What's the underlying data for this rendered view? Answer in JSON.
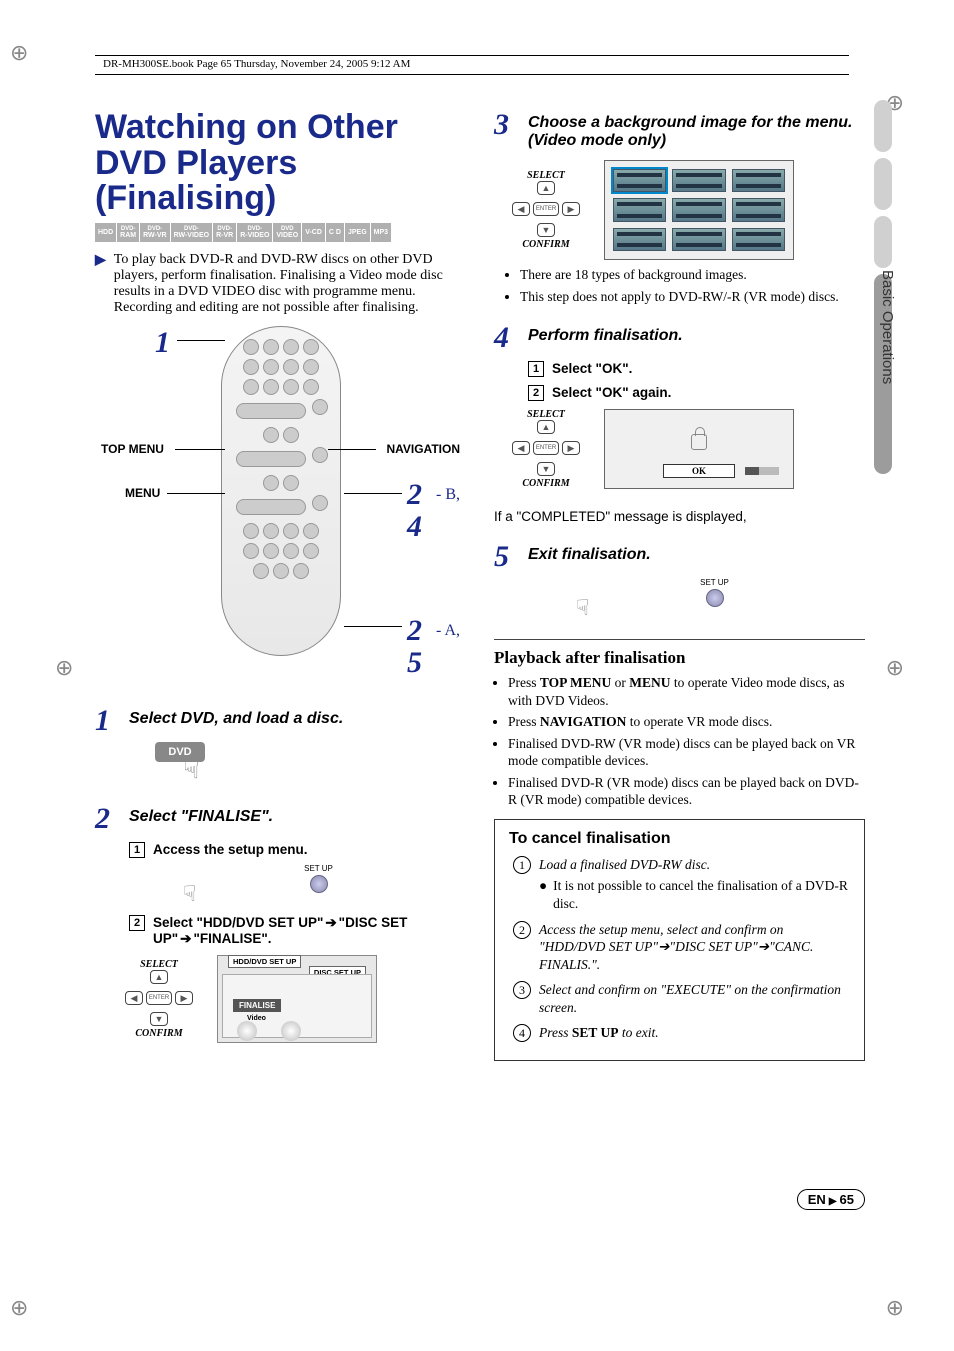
{
  "header_text": "DR-MH300SE.book  Page 65  Thursday, November 24, 2005  9:12 AM",
  "side_label": "Basic Operations",
  "title": "Watching on Other DVD Players (Finalising)",
  "badges": [
    {
      "l1": "",
      "l2": "HDD"
    },
    {
      "l1": "DVD-",
      "l2": "RAM"
    },
    {
      "l1": "DVD-",
      "l2": "RW-VR"
    },
    {
      "l1": "DVD-",
      "l2": "RW-VIDEO"
    },
    {
      "l1": "DVD-",
      "l2": "R-VR"
    },
    {
      "l1": "DVD-",
      "l2": "R-VIDEO"
    },
    {
      "l1": "DVD",
      "l2": "VIDEO"
    },
    {
      "l1": "",
      "l2": "V-CD"
    },
    {
      "l1": "",
      "l2": "C D"
    },
    {
      "l1": "",
      "l2": "JPEG"
    },
    {
      "l1": "",
      "l2": "MP3"
    }
  ],
  "intro": "To play back DVD-R and DVD-RW discs on other DVD players, perform finalisation. Finalising a Video mode disc results in a DVD VIDEO disc with programme menu. Recording and editing are not possible after finalising.",
  "diag": {
    "top_menu": "TOP MENU",
    "menu": "MENU",
    "navigation": "NAVIGATION",
    "n1": "1",
    "n2": "2",
    "n4": "4",
    "n5": "5",
    "sub2": "- B,",
    "sub5": "- A,"
  },
  "step1": {
    "num": "1",
    "title": "Select DVD, and load a disc.",
    "btn": "DVD"
  },
  "step2": {
    "num": "2",
    "title": "Select \"FINALISE\".",
    "sub1_box": "1",
    "sub1": "Access the setup menu.",
    "setup": "SET UP",
    "sub2_box": "2",
    "sub2_pre": "Select \"",
    "sub2_a": "HDD/DVD SET UP",
    "sub2_b": "DISC SET UP",
    "sub2_c": "FINALISE",
    "sub2_end": "\".",
    "select": "SELECT",
    "confirm": "CONFIRM",
    "enter": "ENTER",
    "menu_tab1": "HDD/DVD SET UP",
    "menu_tab2": "DISC SET UP",
    "finalise": "FINALISE",
    "video": "Video"
  },
  "step3": {
    "num": "3",
    "title": "Choose a background image for the menu. (Video mode only)",
    "select": "SELECT",
    "confirm": "CONFIRM",
    "enter": "ENTER",
    "bullet1": "There are 18 types of background images.",
    "bullet2": "This step does not apply to DVD-RW/-R (VR mode) discs."
  },
  "step4": {
    "num": "4",
    "title": "Perform finalisation.",
    "sub1_box": "1",
    "sub1_pre": "Select \"",
    "sub1_b": "OK",
    "sub1_end": "\".",
    "sub2_box": "2",
    "sub2_pre": "Select \"",
    "sub2_b": "OK",
    "sub2_end": "\" again.",
    "select": "SELECT",
    "confirm": "CONFIRM",
    "enter": "ENTER",
    "ok": "OK",
    "completed": "If a \"COMPLETED\" message is displayed,"
  },
  "step5": {
    "num": "5",
    "title": "Exit finalisation.",
    "setup": "SET UP"
  },
  "after": {
    "head": "Playback after finalisation",
    "b1a": "Press ",
    "b1b": "TOP MENU",
    "b1c": " or ",
    "b1d": "MENU",
    "b1e": " to operate Video mode discs, as with DVD Videos.",
    "b2a": "Press ",
    "b2b": "NAVIGATION",
    "b2c": " to operate VR mode discs.",
    "b3": "Finalised DVD-RW (VR mode) discs can be played back on VR mode compatible devices.",
    "b4": "Finalised DVD-R (VR mode) discs can be played back on DVD-R (VR mode) compatible devices."
  },
  "cancel": {
    "head": "To cancel finalisation",
    "i1": "Load a finalised DVD-RW disc.",
    "i1sub": "It is not possible to cancel the finalisation of a DVD-R disc.",
    "i2a": "Access the setup menu, select and confirm on \"HDD/DVD SET UP\"",
    "i2b": "\"DISC SET UP\"",
    "i2c": "\"CANC. FINALIS.\".",
    "i3": "Select and confirm on \"EXECUTE\" on the confirmation screen.",
    "i4a": "Press ",
    "i4b": "SET UP",
    "i4c": " to exit."
  },
  "footer": {
    "en": "EN",
    "num": "65"
  }
}
